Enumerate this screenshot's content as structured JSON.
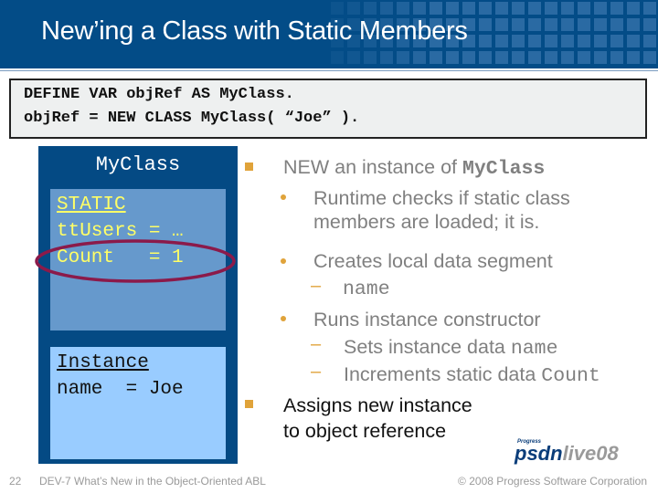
{
  "header": {
    "title": "New’ing a Class with Static Members"
  },
  "code": {
    "lines": [
      "DEFINE VAR objRef AS MyClass.",
      "objRef = NEW CLASS MyClass( “Joe” )."
    ]
  },
  "diagram": {
    "class_name": "MyClass",
    "static_section": {
      "heading": "STATIC",
      "lines": [
        "ttUsers = …",
        "Count   = 1"
      ]
    },
    "instance_section": {
      "heading": "Instance",
      "lines": [
        "name  = Joe"
      ]
    },
    "highlight_color": "#8B1A4A"
  },
  "bullets": {
    "b1": {
      "prefix": "NEW an instance of ",
      "code": "MyClass"
    },
    "b1_1": {
      "line1": "Runtime checks if static class",
      "line2": "members are loaded; it is."
    },
    "b1_2": {
      "text": "Creates local data segment"
    },
    "b1_2_1": {
      "code": "name"
    },
    "b1_3": {
      "text": "Runs instance constructor"
    },
    "b1_3_1": {
      "prefix": "Sets instance data ",
      "code": "name"
    },
    "b1_3_2": {
      "prefix": "Increments static data ",
      "code": "Count"
    },
    "b2": {
      "line1": "Assigns new instance",
      "line2": "to object reference"
    }
  },
  "footer": {
    "slide_number": "22",
    "session": "DEV-7 What’s New in the Object-Oriented ABL",
    "copyright": "© 2008 Progress Software Corporation",
    "logo": {
      "small": "Progress",
      "part1": "psdn",
      "part2": "live08"
    }
  },
  "colors": {
    "header_bg": "#034C87",
    "class_box": "#044A84",
    "static_box": "#6699CC",
    "instance_box": "#99CCFF",
    "bullet": "#E0A33A"
  }
}
